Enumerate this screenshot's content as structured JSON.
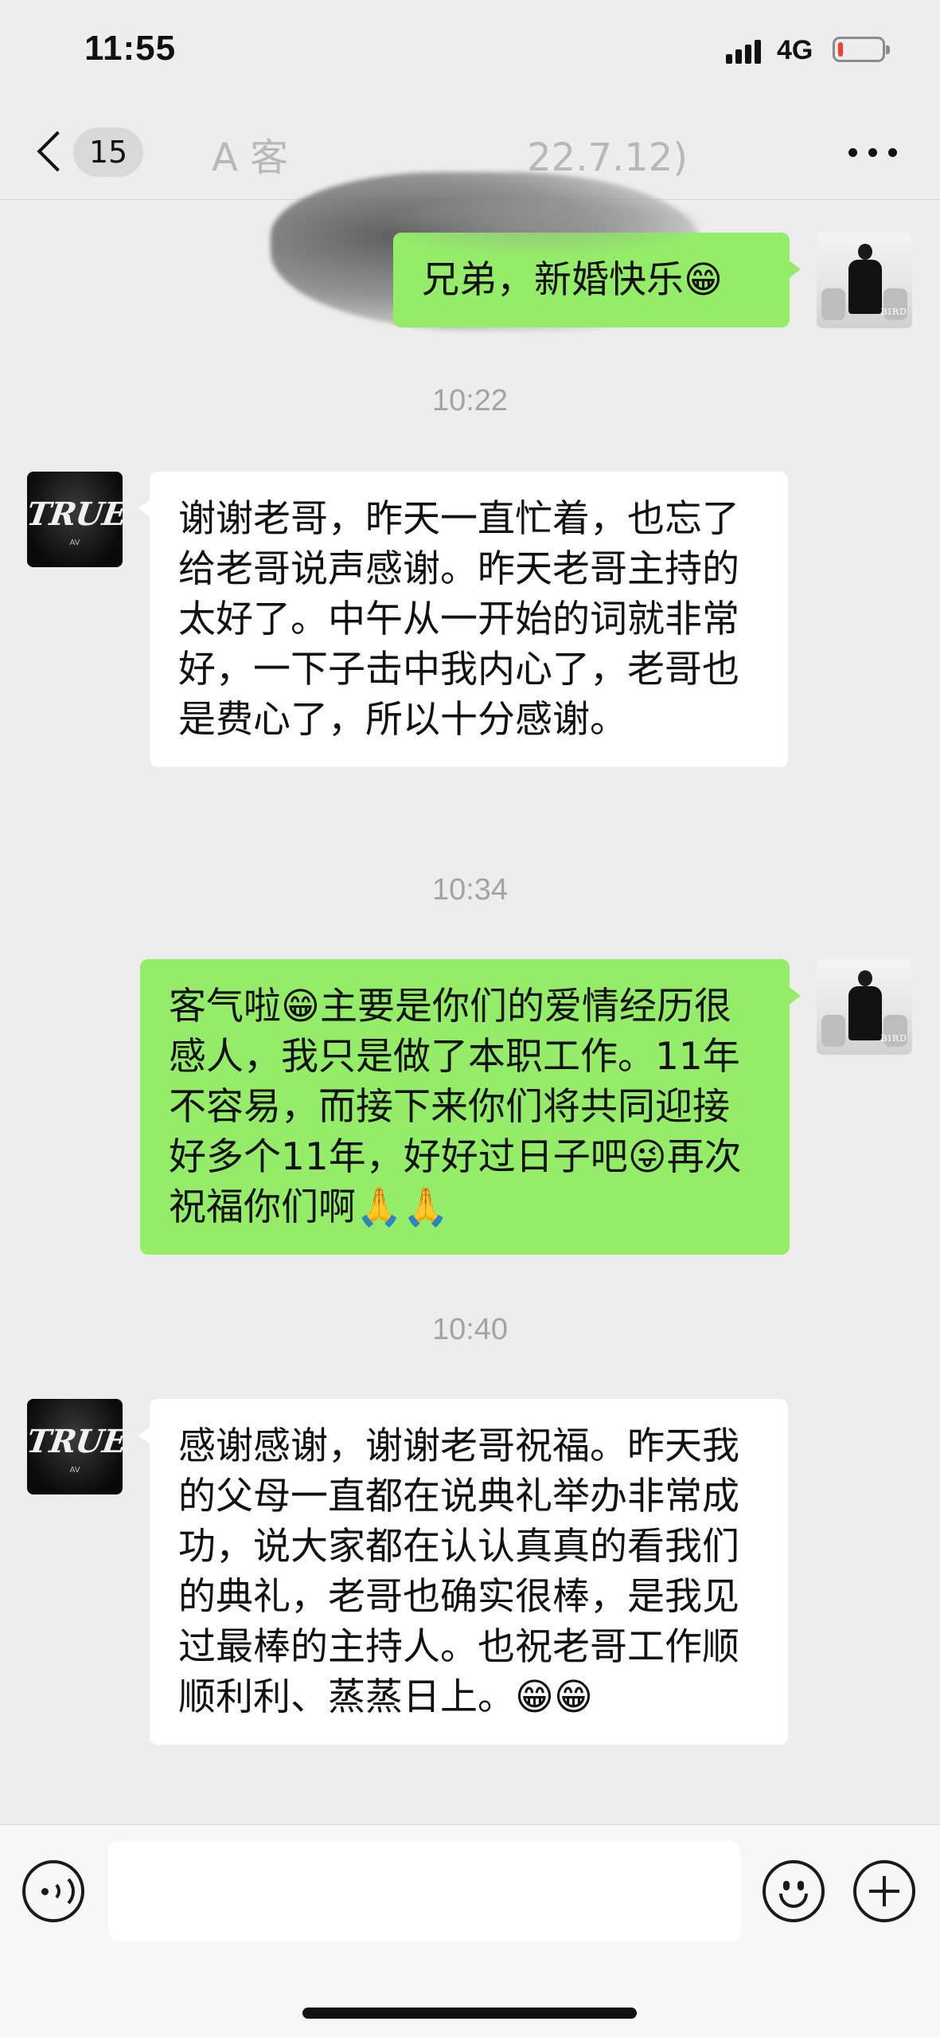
{
  "status_bar": {
    "time": "11:55",
    "network": "4G",
    "battery_level": 0.1,
    "battery_color": "#ff3b30"
  },
  "nav": {
    "back_icon": "chevron-left-icon",
    "unread_count": "15",
    "title_visible": "A 客",
    "title_suffix": "22.7.12)",
    "more_icon": "ellipsis-icon"
  },
  "colors": {
    "self_bubble": "#95ec69",
    "other_bubble": "#ffffff",
    "background": "#ededed",
    "timestamp": "#a3a3a3"
  },
  "messages": [
    {
      "type": "message",
      "sender": "self",
      "text": "兄弟，新婚快乐😁"
    },
    {
      "type": "time",
      "text": "10:22"
    },
    {
      "type": "message",
      "sender": "other",
      "text": "谢谢老哥，昨天一直忙着，也忘了给老哥说声感谢。昨天老哥主持的太好了。中午从一开始的词就非常好，一下子击中我内心了，老哥也是费心了，所以十分感谢。"
    },
    {
      "type": "time",
      "text": "10:34"
    },
    {
      "type": "message",
      "sender": "self",
      "text": "客气啦😁主要是你们的爱情经历很感人，我只是做了本职工作。11年不容易，而接下来你们将共同迎接好多个11年，好好过日子吧😜再次祝福你们啊🙏🙏"
    },
    {
      "type": "time",
      "text": "10:40"
    },
    {
      "type": "message",
      "sender": "other",
      "text": "感谢感谢，谢谢老哥祝福。昨天我的父母一直都在说典礼举办非常成功，说大家都在认认真真的看我们的典礼，老哥也确实很棒，是我见过最棒的主持人。也祝老哥工作顺顺利利、蒸蒸日上。😁😁"
    }
  ],
  "avatars": {
    "self_caption": "BIRD",
    "other_logo": "TRUE",
    "other_mark": "AV"
  },
  "input_bar": {
    "voice_icon": "voice-icon",
    "input_value": "",
    "emoji_icon": "emoji-icon",
    "plus_icon": "plus-icon"
  }
}
